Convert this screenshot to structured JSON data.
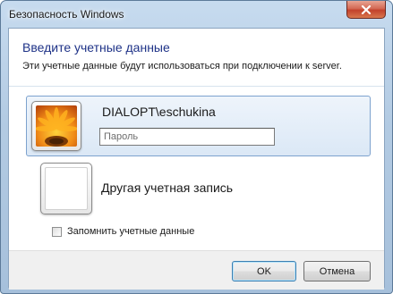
{
  "window": {
    "title": "Безопасность Windows"
  },
  "header": {
    "title": "Введите учетные данные",
    "subtitle": "Эти учетные данные будут использоваться при подключении к server."
  },
  "credentials": {
    "user": "DIALOPT\\eschukina",
    "password_placeholder": "Пароль",
    "password_value": ""
  },
  "other": {
    "label": "Другая учетная запись"
  },
  "remember": {
    "label": "Запомнить учетные данные",
    "checked": false
  },
  "buttons": {
    "ok": "OK",
    "cancel": "Отмена"
  },
  "icons": {
    "close": "close-icon",
    "user_picture": "flower-icon"
  }
}
